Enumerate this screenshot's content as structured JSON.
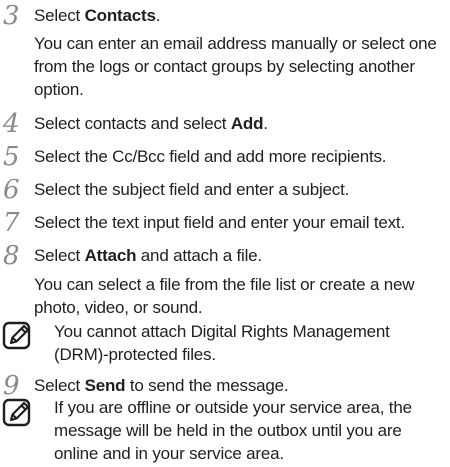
{
  "steps": [
    {
      "number": "3",
      "pre": "Select ",
      "bold": "Contacts",
      "post": ".",
      "detail": "You can enter an email address manually or select one from the logs or contact groups by selecting another option."
    },
    {
      "number": "4",
      "pre": "Select contacts and select ",
      "bold": "Add",
      "post": "."
    },
    {
      "number": "5",
      "text": "Select the Cc/Bcc field and add more recipients."
    },
    {
      "number": "6",
      "text": "Select the subject field and enter a subject."
    },
    {
      "number": "7",
      "text": "Select the text input field and enter your email text."
    },
    {
      "number": "8",
      "pre": "Select ",
      "bold": "Attach",
      "post": " and attach a file.",
      "detail": "You can select a file from the file list or create a new photo, video, or sound."
    },
    {
      "number": "9",
      "pre": "Select ",
      "bold": "Send",
      "post": " to send the message."
    }
  ],
  "notes": [
    {
      "icon": "note-pencil-icon",
      "text": "You cannot attach Digital Rights Management (DRM)-protected files."
    },
    {
      "icon": "note-pencil-icon",
      "text": "If you are offline or outside your service area, the message will be held in the outbox until you are online and in your service area."
    }
  ]
}
